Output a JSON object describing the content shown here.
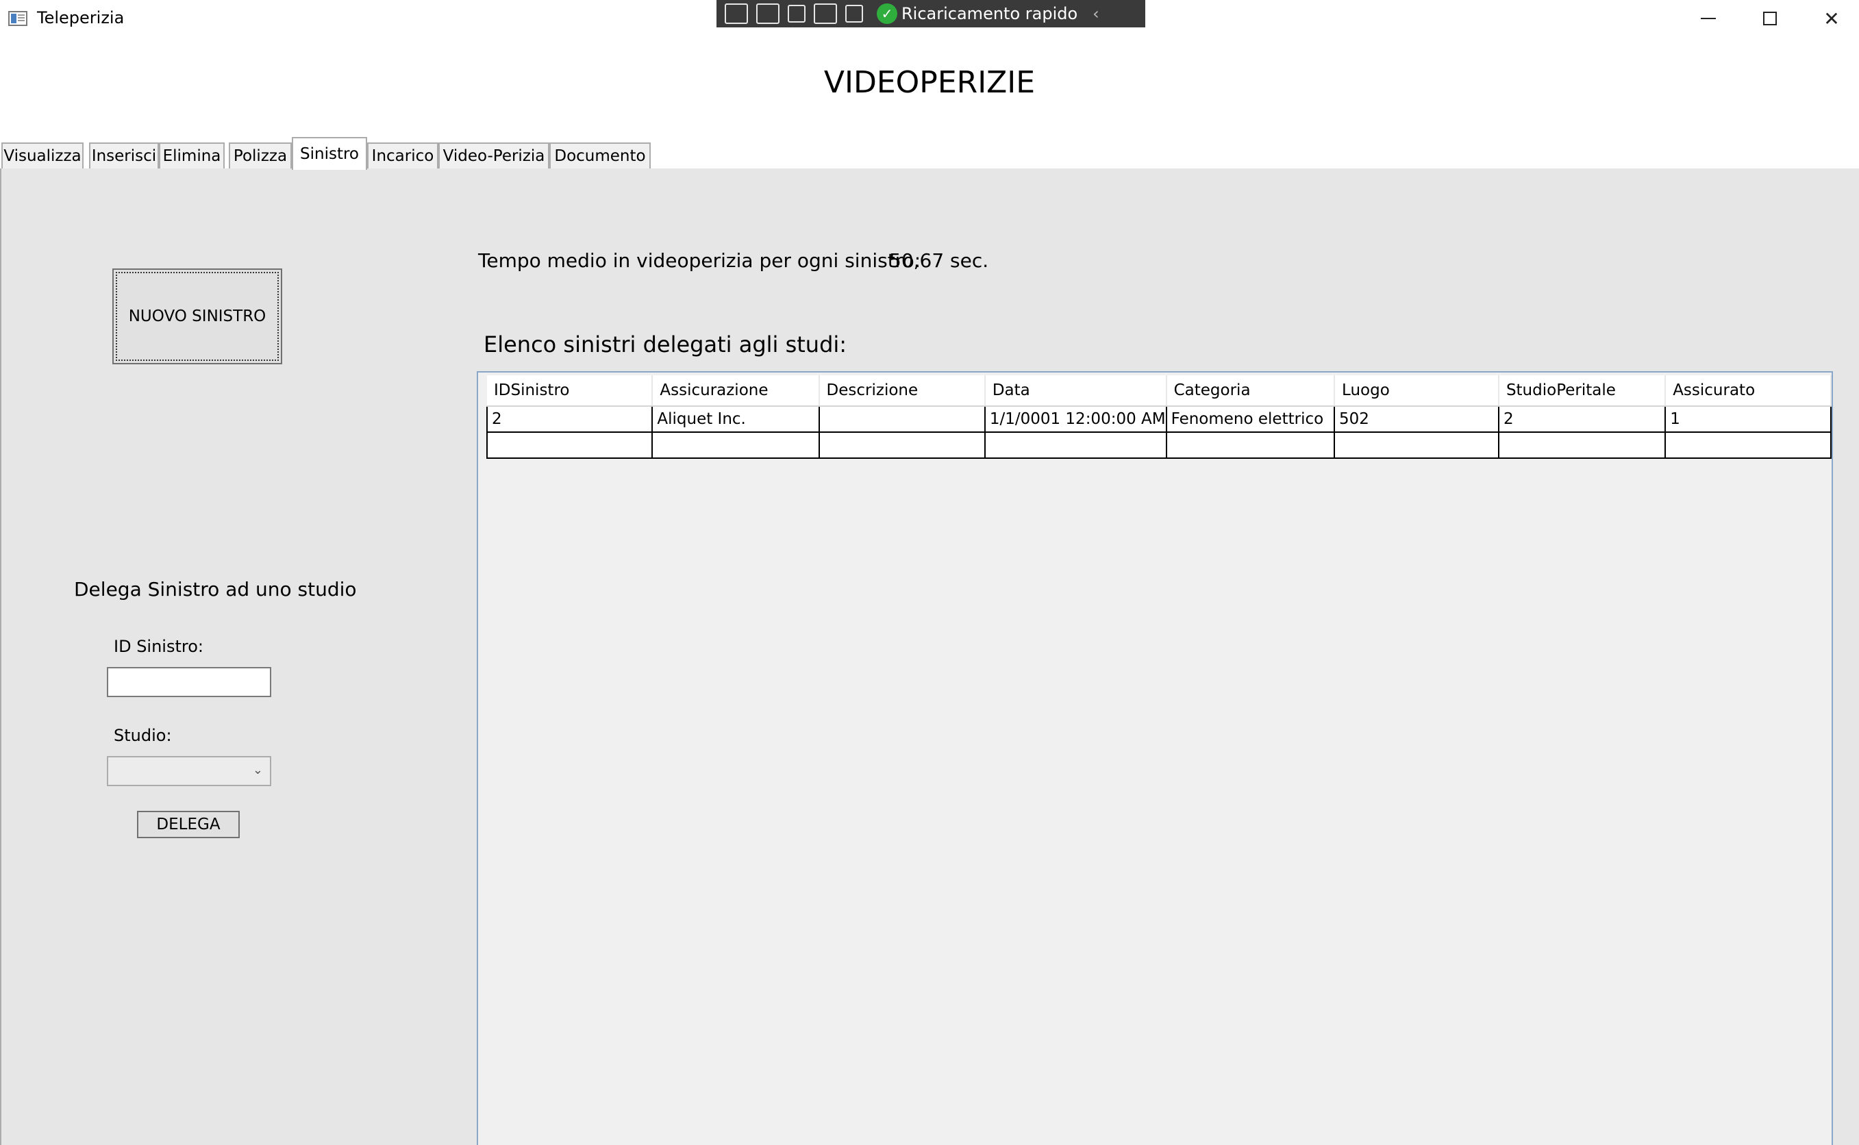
{
  "window": {
    "title": "Teleperizia",
    "minimize_glyph": "",
    "close_glyph": "✕"
  },
  "debug_toolbar": {
    "hot_reload_label": "Ricaricamento rapido",
    "check_glyph": "✓",
    "collapse_glyph": "‹"
  },
  "header": {
    "title": "VIDEOPERIZIE"
  },
  "tabs": [
    {
      "label": "Visualizza"
    },
    {
      "label": "Inserisci"
    },
    {
      "label": "Elimina"
    },
    {
      "label": "Polizza"
    },
    {
      "label": "Sinistro"
    },
    {
      "label": "Incarico"
    },
    {
      "label": "Video-Perizia"
    },
    {
      "label": "Documento"
    }
  ],
  "active_tab": "Sinistro",
  "left_panel": {
    "new_claim_button": "NUOVO SINISTRO",
    "delegate_heading": "Delega Sinistro ad uno studio",
    "claim_id_label": "ID Sinistro:",
    "claim_id_value": "",
    "studio_label": "Studio:",
    "studio_value": "",
    "delegate_button": "DELEGA"
  },
  "stats": {
    "avg_label": "Tempo medio in videoperizia per ogni sinistro:",
    "avg_value": "50,67 sec."
  },
  "claims": {
    "heading": "Elenco sinistri delegati agli studi:",
    "columns": [
      "IDSinistro",
      "Assicurazione",
      "Descrizione",
      "Data",
      "Categoria",
      "Luogo",
      "StudioPeritale",
      "Assicurato"
    ],
    "rows": [
      [
        "2",
        "Aliquet Inc.",
        "",
        "1/1/0001 12:00:00 AM",
        "Fenomeno elettrico",
        "502",
        "2",
        "1"
      ],
      [
        "",
        "",
        "",
        "",
        "",
        "",
        "",
        ""
      ]
    ]
  },
  "colors": {
    "content_background": "#e6e6e6",
    "grid_border": "#8aa6c8",
    "hot_reload_green": "#2fae3e"
  }
}
